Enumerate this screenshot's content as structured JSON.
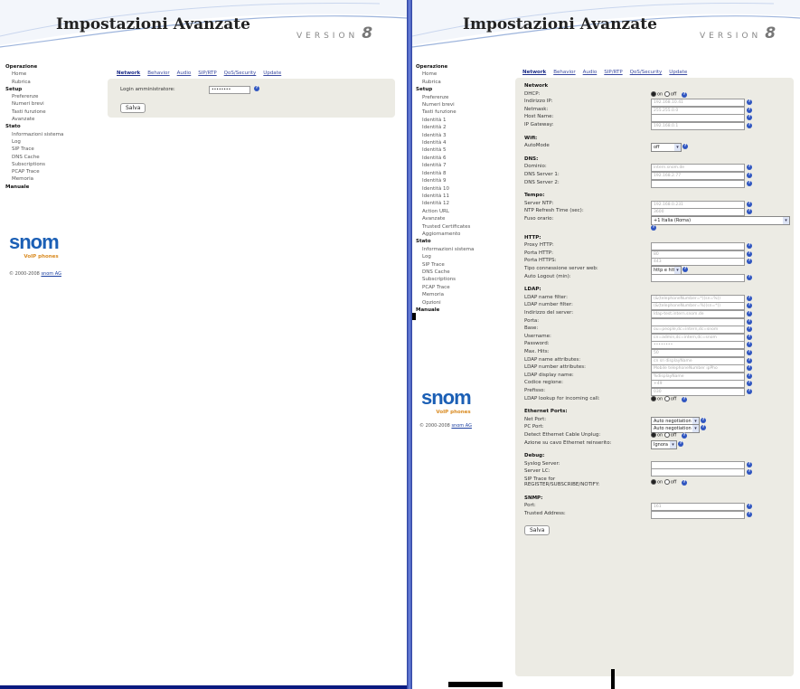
{
  "app": {
    "title": "Impostazioni Avanzate",
    "version_label": "VERSION",
    "version_number": "8"
  },
  "left": {
    "sidebar": [
      {
        "t": "Operazione",
        "cat": true
      },
      {
        "t": "Home"
      },
      {
        "t": "Rubrica"
      },
      {
        "t": "Setup",
        "cat": true
      },
      {
        "t": "Preferenze"
      },
      {
        "t": "Numeri brevi"
      },
      {
        "t": "Tasti funzione"
      },
      {
        "t": "Avanzate"
      },
      {
        "t": "Stato",
        "cat": true
      },
      {
        "t": "Informazioni sistema"
      },
      {
        "t": "Log"
      },
      {
        "t": "SIP Trace"
      },
      {
        "t": "DNS Cache"
      },
      {
        "t": "Subscriptions"
      },
      {
        "t": "PCAP Trace"
      },
      {
        "t": "Memoria"
      },
      {
        "t": "Manuale",
        "cat": true
      }
    ],
    "tabs": [
      "Network",
      "Behavior",
      "Audio",
      "SIP/RTP",
      "QoS/Security",
      "Update"
    ],
    "login_label": "Login amministratore:",
    "login_value": "••••••••",
    "save": "Salva"
  },
  "logo": {
    "word": "snom",
    "tag": "VoIP phones"
  },
  "copyright": {
    "text": "© 2000-2008 ",
    "link": "snom AG"
  },
  "right": {
    "sidebar": [
      {
        "t": "Operazione",
        "cat": true
      },
      {
        "t": "Home"
      },
      {
        "t": "Rubrica"
      },
      {
        "t": "Setup",
        "cat": true
      },
      {
        "t": "Preferenze"
      },
      {
        "t": "Numeri brevi"
      },
      {
        "t": "Tasti funzione"
      },
      {
        "t": "Identità 1"
      },
      {
        "t": "Identità 2"
      },
      {
        "t": "Identità 3"
      },
      {
        "t": "Identità 4"
      },
      {
        "t": "Identità 5"
      },
      {
        "t": "Identità 6"
      },
      {
        "t": "Identità 7"
      },
      {
        "t": "Identità 8"
      },
      {
        "t": "Identità 9"
      },
      {
        "t": "Identità 10"
      },
      {
        "t": "Identità 11"
      },
      {
        "t": "Identità 12"
      },
      {
        "t": "Action URL"
      },
      {
        "t": "Avanzate"
      },
      {
        "t": "Trusted Certificates"
      },
      {
        "t": "Aggiornamento"
      },
      {
        "t": "Stato",
        "cat": true
      },
      {
        "t": "Informazioni sistema"
      },
      {
        "t": "Log"
      },
      {
        "t": "SIP Trace"
      },
      {
        "t": "DNS Cache"
      },
      {
        "t": "Subscriptions"
      },
      {
        "t": "PCAP Trace"
      },
      {
        "t": "Memoria"
      },
      {
        "t": "Opzioni"
      },
      {
        "t": "Manuale",
        "cat": true
      }
    ],
    "tabs": [
      "Network",
      "Behavior",
      "Audio",
      "SIP/RTP",
      "QoS/Security",
      "Update"
    ],
    "rows": [
      {
        "k": "sec",
        "t": "Network"
      },
      {
        "k": "radio",
        "t": "DHCP:",
        "on": "on",
        "off": "off",
        "sel": "on"
      },
      {
        "k": "inp",
        "t": "Indirizzo IP:",
        "v": "192.168.10.41"
      },
      {
        "k": "inp",
        "t": "Netmask:",
        "v": "255.255.0.0"
      },
      {
        "k": "inp",
        "t": "Host Name:",
        "v": ""
      },
      {
        "k": "inp",
        "t": "IP Gateway:",
        "v": "192.168.0.1"
      },
      {
        "k": "gap"
      },
      {
        "k": "sec",
        "t": "Wifi:"
      },
      {
        "k": "sel",
        "t": "AutoMode",
        "v": "off",
        "w": 30
      },
      {
        "k": "gap"
      },
      {
        "k": "sec",
        "t": "DNS:"
      },
      {
        "k": "inp",
        "t": "Dominio:",
        "v": "intern.snom.de"
      },
      {
        "k": "inp",
        "t": "DNS Server 1:",
        "v": "192.168.2.77"
      },
      {
        "k": "inp",
        "t": "DNS Server 2:",
        "v": ""
      },
      {
        "k": "gap"
      },
      {
        "k": "sec",
        "t": "Tempo:"
      },
      {
        "k": "inp",
        "t": "Server NTP:",
        "v": "192.168.0.231"
      },
      {
        "k": "inp",
        "t": "NTP Refresh Time (sec):",
        "v": "3600"
      },
      {
        "k": "wide",
        "t": "Fuso orario:",
        "v": "+1 Italia (Roma)"
      },
      {
        "k": "gap"
      },
      {
        "k": "sec",
        "t": "HTTP:"
      },
      {
        "k": "inp",
        "t": "Proxy HTTP:",
        "v": ""
      },
      {
        "k": "inp",
        "t": "Porta HTTP:",
        "v": "80"
      },
      {
        "k": "inp",
        "t": "Porta HTTPS:",
        "v": "443"
      },
      {
        "k": "sel",
        "t": "Tipo connessione server web:",
        "v": "http e https",
        "w": 30
      },
      {
        "k": "inp",
        "t": "Auto Logout (min):",
        "v": ""
      },
      {
        "k": "gap"
      },
      {
        "k": "sec",
        "t": "LDAP:"
      },
      {
        "k": "inp",
        "t": "LDAP name filter:",
        "v": "(&(telephoneNumber=*)(sn=%))"
      },
      {
        "k": "inp",
        "t": "LDAP number filter:",
        "v": "(&(telephoneNumber=%)(sn=*))"
      },
      {
        "k": "inp",
        "t": "Indirizzo del server:",
        "v": "ldap-test.intern.snom.de"
      },
      {
        "k": "inp",
        "t": "Porta:",
        "v": ""
      },
      {
        "k": "inp",
        "t": "Base:",
        "v": "ou=people,dc=intern,dc=snom"
      },
      {
        "k": "inp",
        "t": "Username:",
        "v": "cn=admin,dc=intern,dc=snom"
      },
      {
        "k": "inp",
        "t": "Password:",
        "v": "••••••••"
      },
      {
        "k": "inp",
        "t": "Max. Hits:",
        "v": "50"
      },
      {
        "k": "inp",
        "t": "LDAP name attributes:",
        "v": "cn sn displayName"
      },
      {
        "k": "inp",
        "t": "LDAP number attributes:",
        "v": "Mobile telephoneNumber ipPho"
      },
      {
        "k": "inp",
        "t": "LDAP display name:",
        "v": "%displayName"
      },
      {
        "k": "inp",
        "t": "Codice regione:",
        "v": "+49"
      },
      {
        "k": "inp",
        "t": "Prefisso:",
        "v": "030"
      },
      {
        "k": "radio",
        "t": "LDAP lookup for incoming call:",
        "on": "on",
        "off": "off",
        "sel": "on"
      },
      {
        "k": "gap"
      },
      {
        "k": "sec",
        "t": "Ethernet Ports:"
      },
      {
        "k": "sel",
        "t": "Net Port:",
        "v": "Auto negotiation",
        "w": 50
      },
      {
        "k": "sel",
        "t": "PC Port:",
        "v": "Auto negotiation",
        "w": 50
      },
      {
        "k": "radio",
        "t": "Detect Ethernet Cable Unplug:",
        "on": "on",
        "off": "off",
        "sel": "on"
      },
      {
        "k": "sel",
        "t": "Azione su cavo Ethernet reinserito:",
        "v": "Ignora",
        "w": 25
      },
      {
        "k": "gap"
      },
      {
        "k": "sec",
        "t": "Debug:"
      },
      {
        "k": "inp",
        "t": "Syslog Server:",
        "v": ""
      },
      {
        "k": "inp",
        "t": "Server LC:",
        "v": ""
      },
      {
        "k": "radio2",
        "t": "SIP Trace for",
        "t2": "REGISTER/SUBSCRIBE/NOTIFY:",
        "on": "on",
        "off": "off",
        "sel": "on"
      },
      {
        "k": "gap"
      },
      {
        "k": "sec",
        "t": "SNMP:"
      },
      {
        "k": "inp",
        "t": "Port:",
        "v": "161"
      },
      {
        "k": "inp",
        "t": "Trusted Address:",
        "v": ""
      }
    ],
    "save": "Salva"
  }
}
